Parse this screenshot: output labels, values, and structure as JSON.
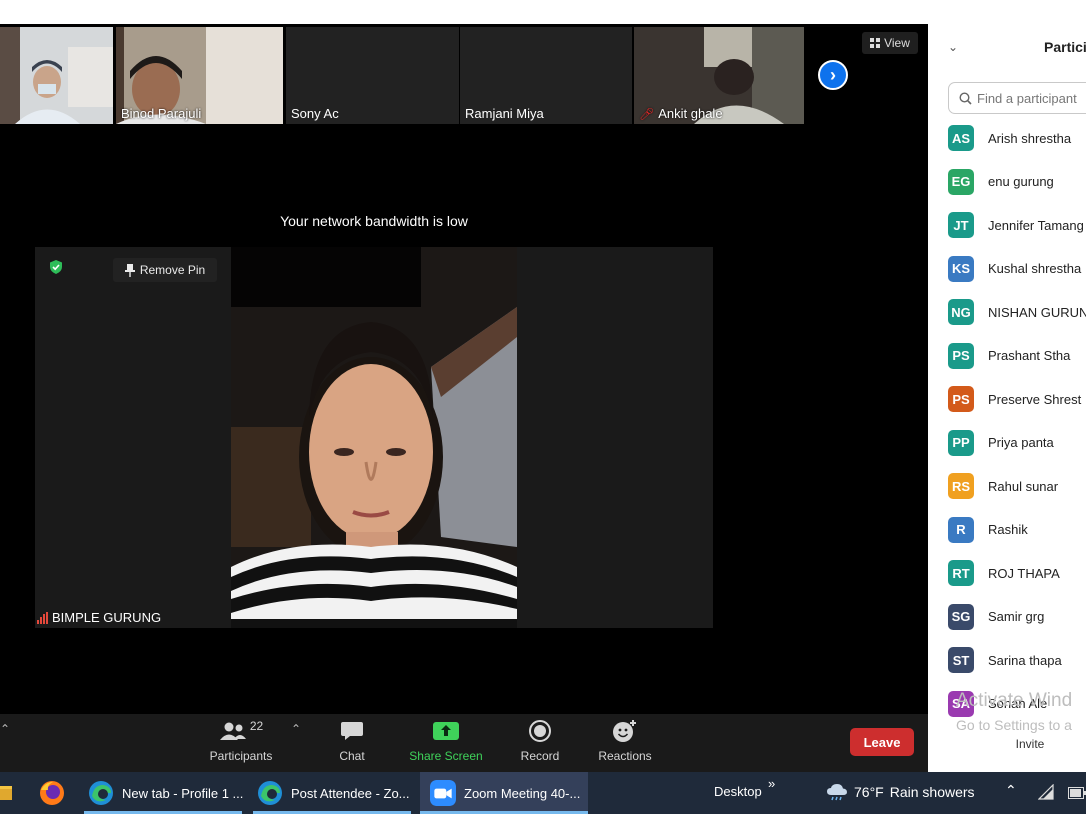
{
  "thumbnails": [
    {
      "name": "",
      "muted": false
    },
    {
      "name": "Binod Parajuli",
      "muted": false
    },
    {
      "name": "Sony Ac",
      "muted": false
    },
    {
      "name": "Ramjani Miya",
      "muted": false
    },
    {
      "name": "Ankit ghale",
      "muted": true
    }
  ],
  "view_button": {
    "label": "View",
    "icon": "grid-icon"
  },
  "next_page": {
    "icon": "chevron-right-icon"
  },
  "network_message": "Your network bandwidth is low",
  "pinned": {
    "remove_pin_label": "Remove Pin",
    "name": "BIMPLE GURUNG",
    "security_icon": "shield-icon",
    "pin_icon": "pin-icon",
    "signal_icon": "signal-bars-icon",
    "signal_color": "#e5483b"
  },
  "toolbar": {
    "participants_count": "22",
    "participants_label": "Participants",
    "chat_label": "Chat",
    "share_label": "Share Screen",
    "record_label": "Record",
    "reactions_label": "Reactions",
    "leave_label": "Leave",
    "share_color": "#3fd25a",
    "leave_color": "#cd2e2e"
  },
  "panel": {
    "title": "Partici",
    "search_placeholder": "Find a participant",
    "participants": [
      {
        "initials": "AS",
        "name": "Arish shrestha",
        "color": "#1a9a8a"
      },
      {
        "initials": "EG",
        "name": "enu gurung",
        "color": "#2aa665"
      },
      {
        "initials": "JT",
        "name": "Jennifer Tamang",
        "color": "#1a9a8a"
      },
      {
        "initials": "KS",
        "name": "Kushal shrestha",
        "color": "#3a7ac2"
      },
      {
        "initials": "NG",
        "name": "NISHAN GURUN",
        "color": "#1a9a8a"
      },
      {
        "initials": "PS",
        "name": "Prashant Stha",
        "color": "#1a9a8a"
      },
      {
        "initials": "PS",
        "name": "Preserve Shrest",
        "color": "#d35a1a"
      },
      {
        "initials": "PP",
        "name": "Priya panta",
        "color": "#1a9a8a"
      },
      {
        "initials": "RS",
        "name": "Rahul sunar",
        "color": "#f0a020"
      },
      {
        "initials": "R",
        "name": "Rashik",
        "color": "#3a7ac2"
      },
      {
        "initials": "RT",
        "name": "ROJ THAPA",
        "color": "#1a9a8a"
      },
      {
        "initials": "SG",
        "name": "Samir grg",
        "color": "#3a4a6a"
      },
      {
        "initials": "ST",
        "name": "Sarina thapa",
        "color": "#3a4a6a"
      },
      {
        "initials": "SA",
        "name": "Sohan Ale",
        "color": "#9a3ab0"
      }
    ],
    "activate_line1": "Activate Wind",
    "activate_line2": "Go to Settings to a",
    "invite_label": "Invite"
  },
  "taskbar": {
    "apps": [
      {
        "label": "New tab - Profile 1 ...",
        "icon": "edge-icon"
      },
      {
        "label": "Post Attendee - Zo...",
        "icon": "edge-icon"
      },
      {
        "label": "Zoom Meeting 40-...",
        "icon": "zoom-icon"
      }
    ],
    "desktop_label": "Desktop",
    "overflow_label": "»",
    "temperature": "76°F",
    "weather": "Rain showers"
  }
}
